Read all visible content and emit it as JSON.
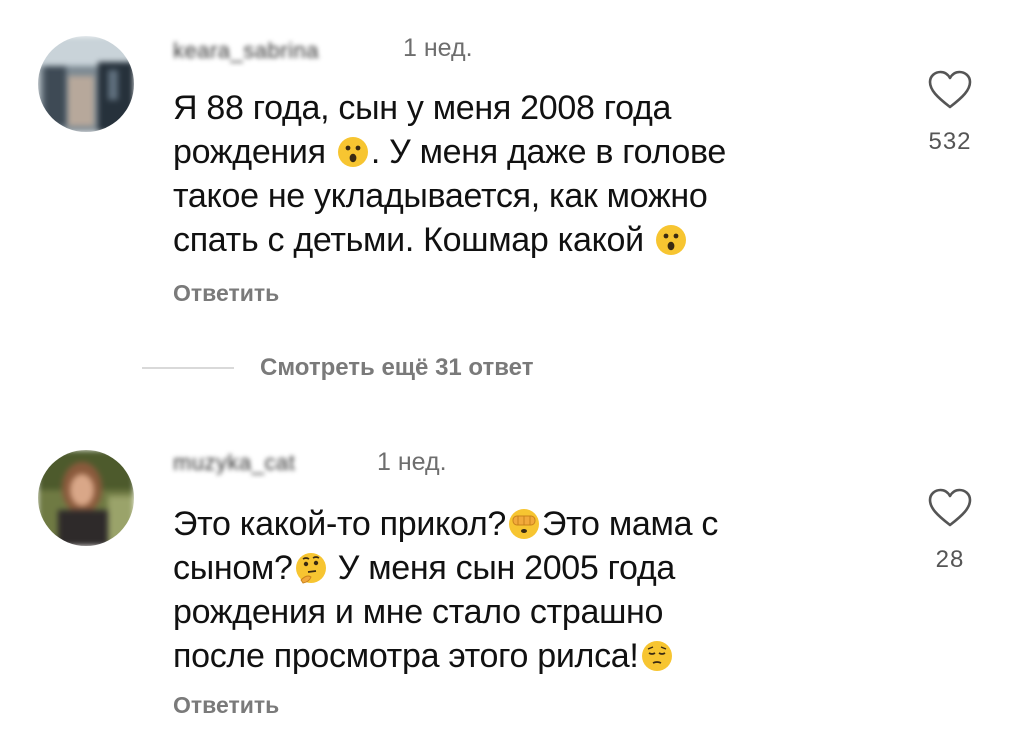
{
  "comments": [
    {
      "username": "keara_sabrina",
      "time": "1 нед.",
      "lines": [
        {
          "before": "Я 88 года, сын у меня 2008 года",
          "emoji": null,
          "after": ""
        },
        {
          "before": "рождения ",
          "emoji": "hushed-face-emoji",
          "after": ". У меня даже в голове"
        },
        {
          "before": "такое не укладывается, как можно",
          "emoji": null,
          "after": ""
        },
        {
          "before": "спать с детьми. Кошмар какой ",
          "emoji": "hushed-face-emoji",
          "after": ""
        }
      ],
      "reply_label": "Ответить",
      "likes": "532"
    },
    {
      "username": "muzyka_cat",
      "time": "1 нед.",
      "lines": [
        {
          "before": "Это какой-то прикол?",
          "emoji": "face-with-hand-over-eyes-emoji",
          "after": "Это мама с"
        },
        {
          "before": "сыном?",
          "emoji": "thinking-face-emoji",
          "after": " У меня сын 2005 года"
        },
        {
          "before": "рождения и мне стало страшно",
          "emoji": null,
          "after": ""
        },
        {
          "before": "после просмотра этого рилса!",
          "emoji": "pensive-face-emoji",
          "after": ""
        }
      ],
      "reply_label": "Ответить",
      "likes": "28"
    }
  ],
  "view_more_replies": "Смотреть ещё 31 ответ",
  "colors": {
    "text": "#111111",
    "secondary": "#7a7a7a",
    "emoji_yellow": "#f7c531",
    "divider": "#d9d9d9"
  }
}
